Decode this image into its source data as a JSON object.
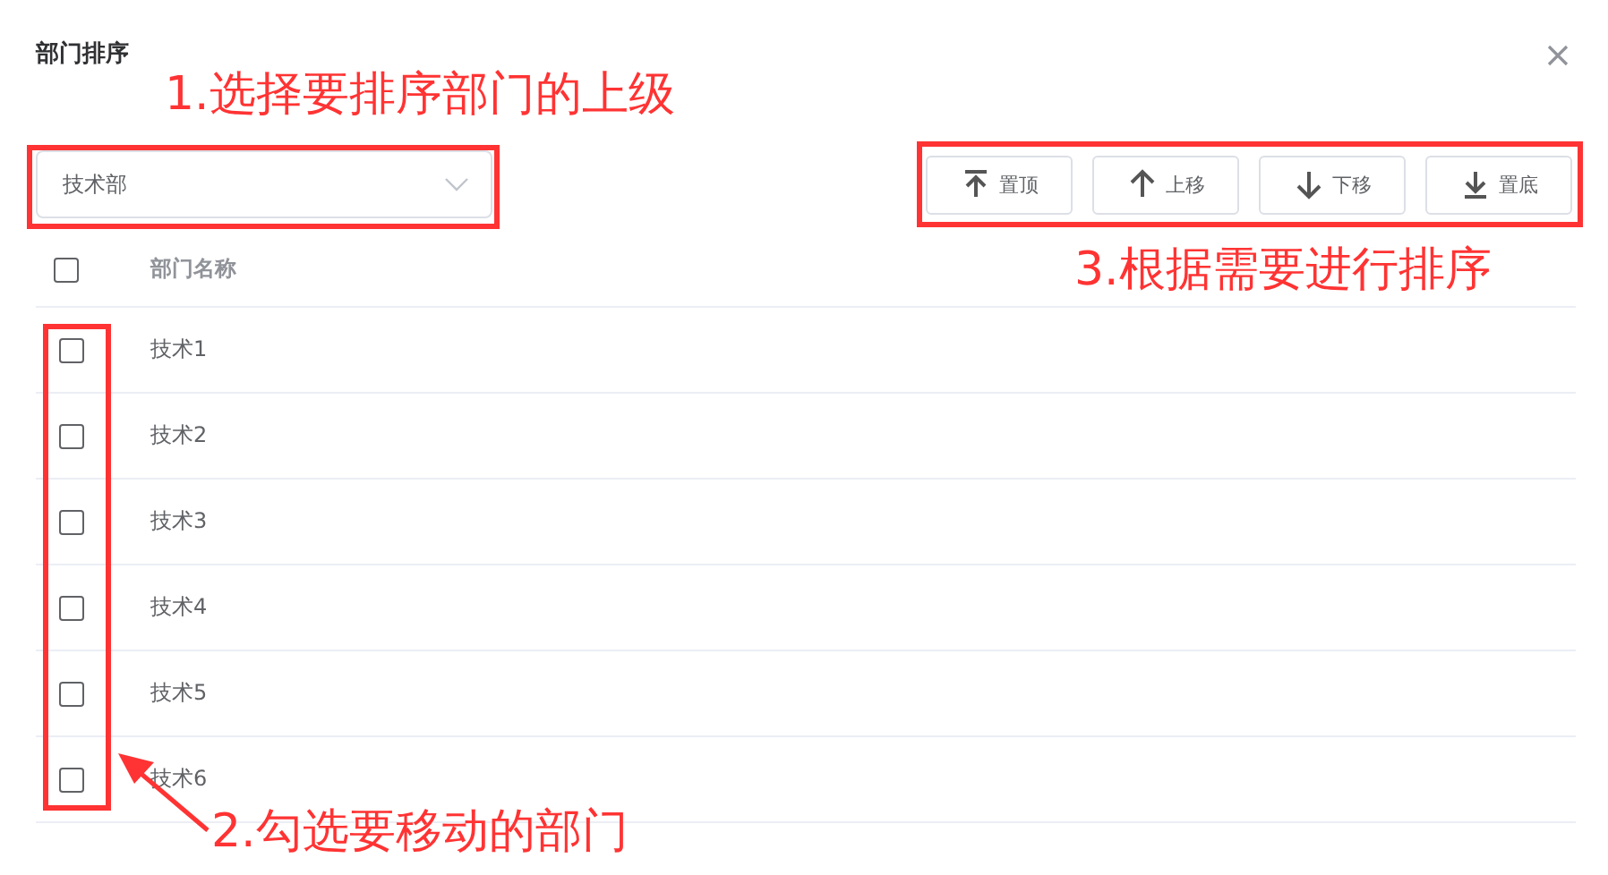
{
  "dialog": {
    "title": "部门排序"
  },
  "parent_select": {
    "value": "技术部"
  },
  "buttons": [
    {
      "kind": "top",
      "label": "置顶"
    },
    {
      "kind": "up",
      "label": "上移"
    },
    {
      "kind": "down",
      "label": "下移"
    },
    {
      "kind": "bottom",
      "label": "置底"
    }
  ],
  "table": {
    "header": {
      "checked": false,
      "column": "部门名称"
    },
    "rows": [
      {
        "name": "技术1",
        "checked": false
      },
      {
        "name": "技术2",
        "checked": false
      },
      {
        "name": "技术3",
        "checked": false
      },
      {
        "name": "技术4",
        "checked": false
      },
      {
        "name": "技术5",
        "checked": false
      },
      {
        "name": "技术6",
        "checked": false
      }
    ]
  },
  "annotations": [
    {
      "kind": "select",
      "text": "1.选择要排序部门的上级"
    },
    {
      "kind": "rows",
      "text": "2.勾选要移动的部门"
    },
    {
      "kind": "buttons",
      "text": "3.根据需要进行排序"
    }
  ]
}
